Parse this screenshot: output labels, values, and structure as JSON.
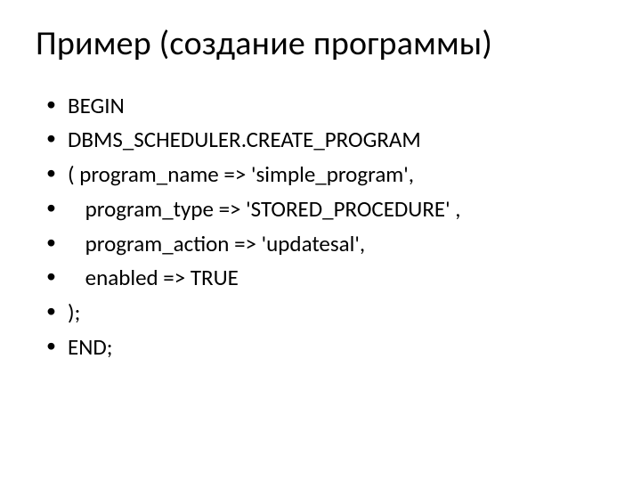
{
  "slide": {
    "title": "Пример (создание программы)",
    "bullets": [
      "BEGIN",
      "DBMS_SCHEDULER.CREATE_PROGRAM",
      "( program_name  => 'simple_program',",
      "  program_type  => 'STORED_PROCEDURE' ,",
      "  program_action => 'updatesal',",
      "  enabled       => TRUE",
      ");",
      "END;"
    ]
  }
}
